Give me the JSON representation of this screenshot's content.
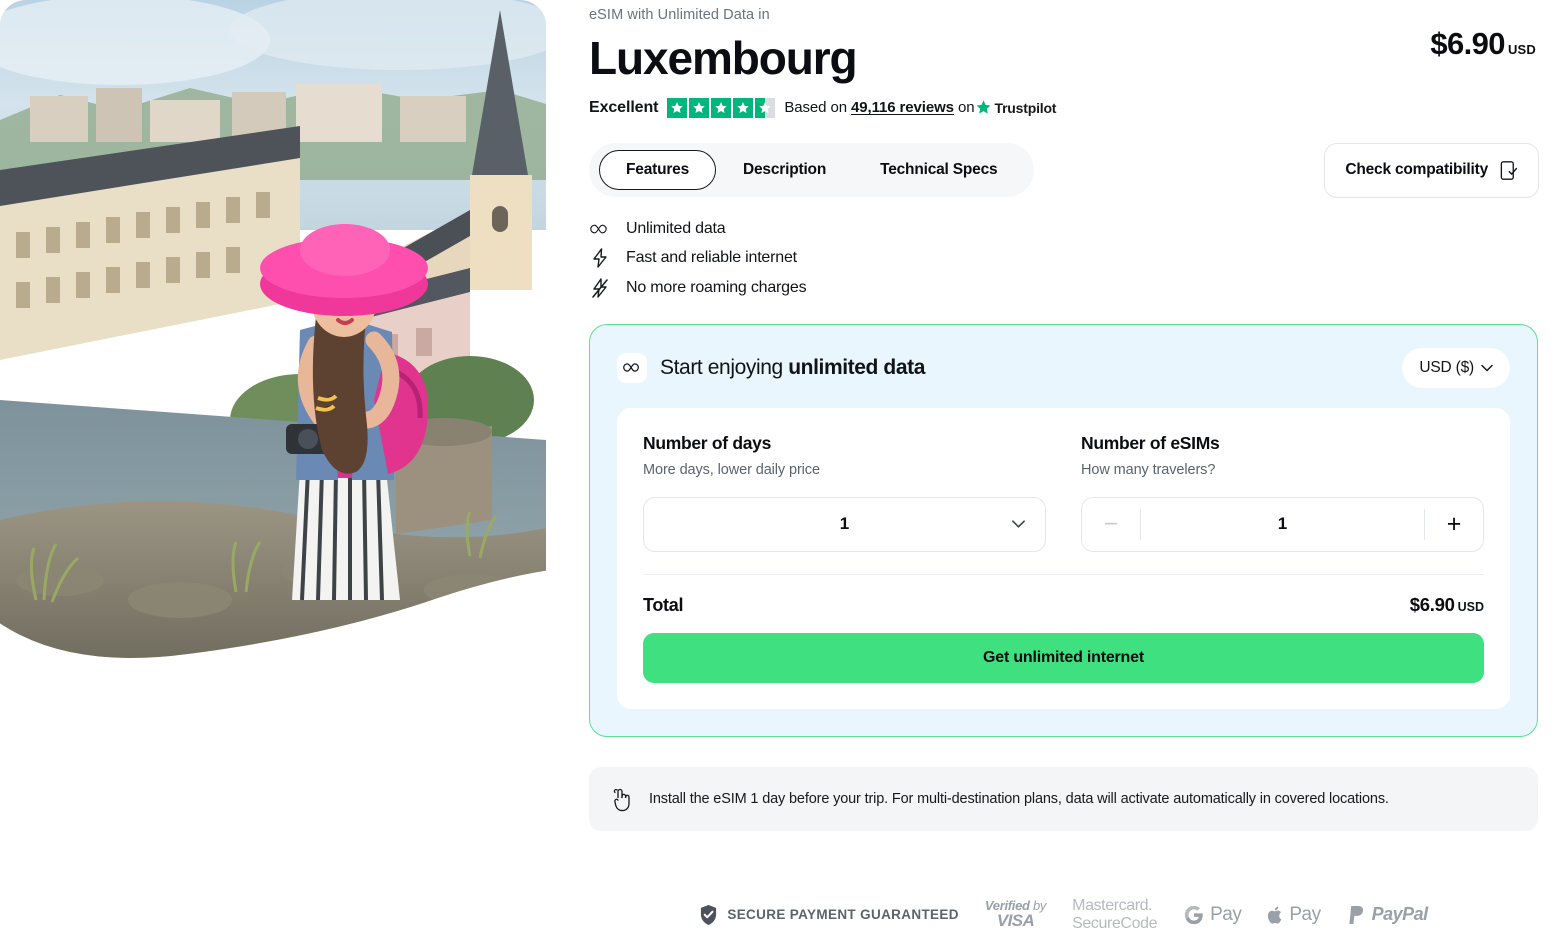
{
  "hero": {
    "alt": "Traveler in pink hat overlooking Luxembourg old town"
  },
  "header": {
    "eyebrow": "eSIM with Unlimited Data in",
    "country": "Luxembourg",
    "price_amount": "$6.90",
    "price_currency": "USD"
  },
  "rating": {
    "word": "Excellent",
    "stars_filled": 4,
    "stars_half": 1,
    "stars_total": 5,
    "prefix": "Based on",
    "reviews": "49,116 reviews",
    "middle": "on",
    "brand": "Trustpilot",
    "star_color": "#00b67a",
    "star_empty_color": "#dcdce6"
  },
  "tabs": [
    {
      "label": "Features",
      "active": true
    },
    {
      "label": "Description",
      "active": false
    },
    {
      "label": "Technical Specs",
      "active": false
    }
  ],
  "compatibility": {
    "label": "Check compatibility",
    "icon": "phone-check-icon"
  },
  "features": [
    {
      "icon": "infinity-icon",
      "label": "Unlimited data"
    },
    {
      "icon": "bolt-icon",
      "label": "Fast and reliable internet"
    },
    {
      "icon": "bolt-slash-icon",
      "label": "No more roaming charges"
    }
  ],
  "purchase": {
    "heading_regular": "Start enjoying ",
    "heading_bold": "unlimited data",
    "currency_selected": "USD ($)",
    "accent_border": "#5fe08f",
    "card_bg": "#eaf6fd",
    "days": {
      "label": "Number of days",
      "sub": "More days, lower daily price",
      "value": "1"
    },
    "esims": {
      "label": "Number of eSIMs",
      "sub": "How many travelers?",
      "value": "1",
      "minus": "−",
      "plus": "+",
      "minus_disabled": true
    },
    "total": {
      "label": "Total",
      "amount": "$6.90",
      "currency": "USD"
    },
    "cta": "Get unlimited internet",
    "cta_color": "#3ee07f"
  },
  "notice": {
    "icon": "finger-reminder-icon",
    "text": "Install the eSIM 1 day before your trip. For multi-destination plans, data will activate automatically in covered locations."
  },
  "payments": {
    "secure_label": "SECURE PAYMENT GUARANTEED",
    "secure_icon": "shield-check-icon",
    "visa_line1_a": "Verified",
    "visa_line1_b": "by",
    "visa_line2": "VISA",
    "mastercard_line1": "Mastercard.",
    "mastercard_line2": "SecureCode",
    "gpay": "Pay",
    "apay": "Pay",
    "paypal": "PayPal"
  }
}
